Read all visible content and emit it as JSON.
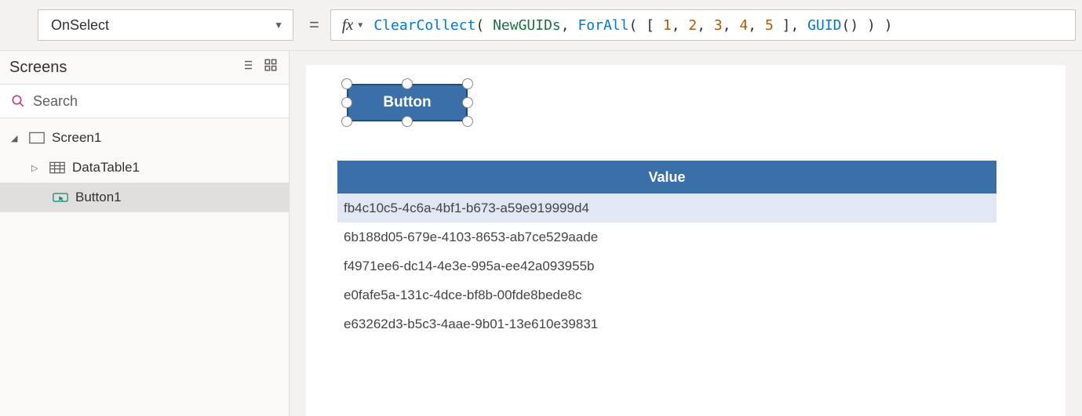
{
  "topbar": {
    "property": "OnSelect",
    "equals": "=",
    "fx": "fx",
    "formula": {
      "f1": "ClearCollect",
      "p1": "( ",
      "id": "NewGUIDs",
      "p2": ", ",
      "f2": "ForAll",
      "p3": "( [ ",
      "n1": "1",
      "c1": ", ",
      "n2": "2",
      "c2": ", ",
      "n3": "3",
      "c3": ", ",
      "n4": "4",
      "c4": ", ",
      "n5": "5",
      "p4": " ], ",
      "f3": "GUID",
      "p5": "() ) )"
    }
  },
  "tree": {
    "title": "Screens",
    "search_placeholder": "Search",
    "items": {
      "screen1": "Screen1",
      "datatable1": "DataTable1",
      "button1": "Button1"
    }
  },
  "canvas": {
    "button_label": "Button",
    "table": {
      "header": "Value",
      "rows": [
        "fb4c10c5-4c6a-4bf1-b673-a59e919999d4",
        "6b188d05-679e-4103-8653-ab7ce529aade",
        "f4971ee6-dc14-4e3e-995a-ee42a093955b",
        "e0fafe5a-131c-4dce-bf8b-00fde8bede8c",
        "e63262d3-b5c3-4aae-9b01-13e610e39831"
      ]
    }
  }
}
